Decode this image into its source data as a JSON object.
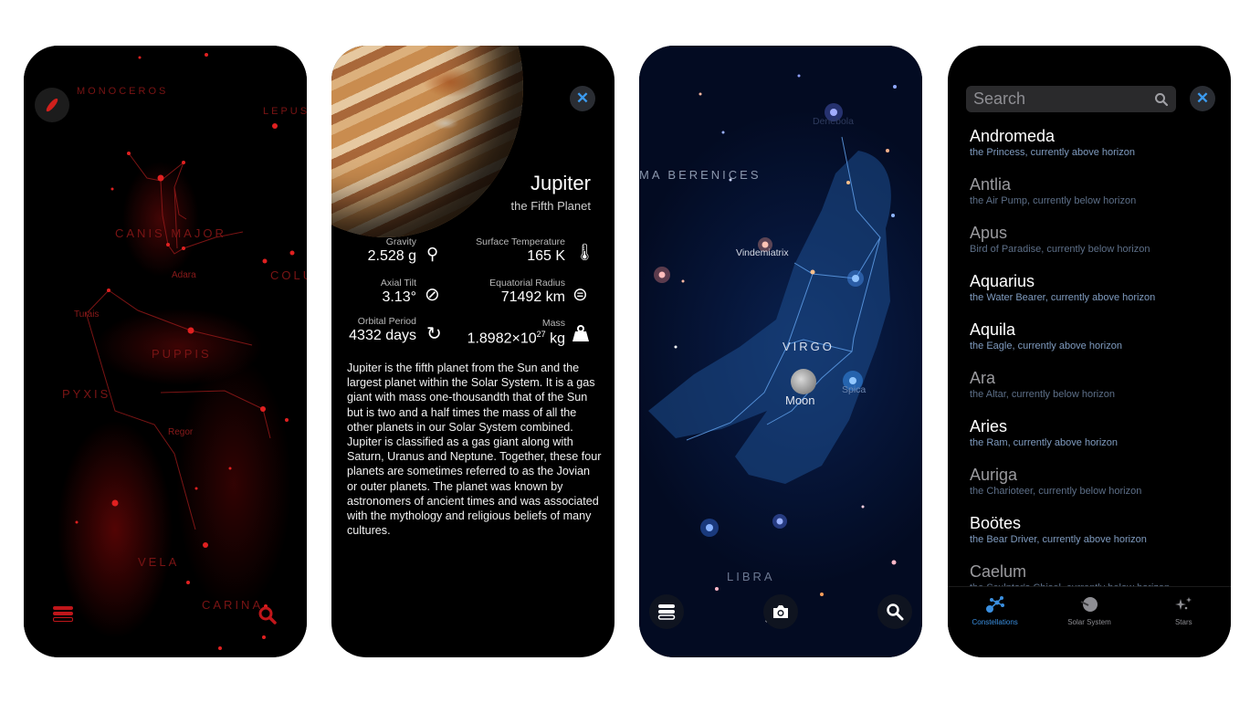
{
  "screen1": {
    "constellation_labels": [
      "CANIS MAJOR",
      "PUPPIS",
      "PYXIS",
      "VELA",
      "CARINA",
      "COLUMBA",
      "MONOCEROS",
      "LEPUS"
    ],
    "star_labels": [
      "Adara",
      "Turais",
      "Regor"
    ],
    "compass_icon": "compass-icon",
    "menu_icon": "list-icon",
    "search_icon": "search-icon",
    "accent_color": "#c0161a"
  },
  "screen2": {
    "title": "Jupiter",
    "subtitle": "the Fifth Planet",
    "close_icon": "close-icon",
    "stats": [
      {
        "label": "Gravity",
        "value": "2.528 g",
        "icon": "gravity-icon"
      },
      {
        "label": "Surface Temperature",
        "value": "165 K",
        "icon": "thermometer-icon"
      },
      {
        "label": "Axial Tilt",
        "value": "3.13°",
        "icon": "planet-tilt-icon"
      },
      {
        "label": "Equatorial Radius",
        "value": "71492 km",
        "icon": "radius-icon"
      },
      {
        "label": "Orbital Period",
        "value": "4332 days",
        "icon": "orbit-icon"
      },
      {
        "label": "Mass",
        "value_base": "1.8982×10",
        "value_exp": "27",
        "value_unit": " kg",
        "icon": "weight-icon"
      }
    ],
    "description": "Jupiter is the fifth planet from the Sun and the largest planet within the Solar System. It is a gas giant with mass one-thousandth that of the Sun but is two and a half times the mass of all the other planets in our Solar System combined. Jupiter is classified as a gas giant along with Saturn, Uranus and Neptune. Together, these four planets are sometimes referred to as the Jovian or outer planets. The planet was known by astronomers of ancient times and was associated with the mythology and religious beliefs of many cultures."
  },
  "screen3": {
    "constellation_labels": [
      "MA BERENICES",
      "VIRGO",
      "LIBRA"
    ],
    "star_labels": [
      "Vindemiatrix",
      "Spica",
      "Denebola"
    ],
    "moon_label": "Moon",
    "buttons": [
      "list-icon",
      "camera-icon",
      "search-icon"
    ]
  },
  "screen4": {
    "search_placeholder": "Search",
    "close_icon": "close-icon",
    "items": [
      {
        "name": "Andromeda",
        "sub": "the Princess, currently above horizon",
        "above": true
      },
      {
        "name": "Antlia",
        "sub": "the Air Pump, currently below horizon",
        "above": false
      },
      {
        "name": "Apus",
        "sub": "Bird of Paradise, currently below horizon",
        "above": false
      },
      {
        "name": "Aquarius",
        "sub": "the Water Bearer, currently above horizon",
        "above": true
      },
      {
        "name": "Aquila",
        "sub": "the Eagle, currently above horizon",
        "above": true
      },
      {
        "name": "Ara",
        "sub": "the Altar, currently below horizon",
        "above": false
      },
      {
        "name": "Aries",
        "sub": "the Ram, currently above horizon",
        "above": true
      },
      {
        "name": "Auriga",
        "sub": "the Charioteer, currently below horizon",
        "above": false
      },
      {
        "name": "Boötes",
        "sub": "the Bear Driver, currently above horizon",
        "above": true
      },
      {
        "name": "Caelum",
        "sub": "the Sculptor's Chisel, currently below horizon",
        "above": false
      }
    ],
    "tabs": [
      {
        "label": "Constellations",
        "active": true
      },
      {
        "label": "Solar System",
        "active": false
      },
      {
        "label": "Stars",
        "active": false
      }
    ],
    "active_color": "#3a8fe0"
  }
}
